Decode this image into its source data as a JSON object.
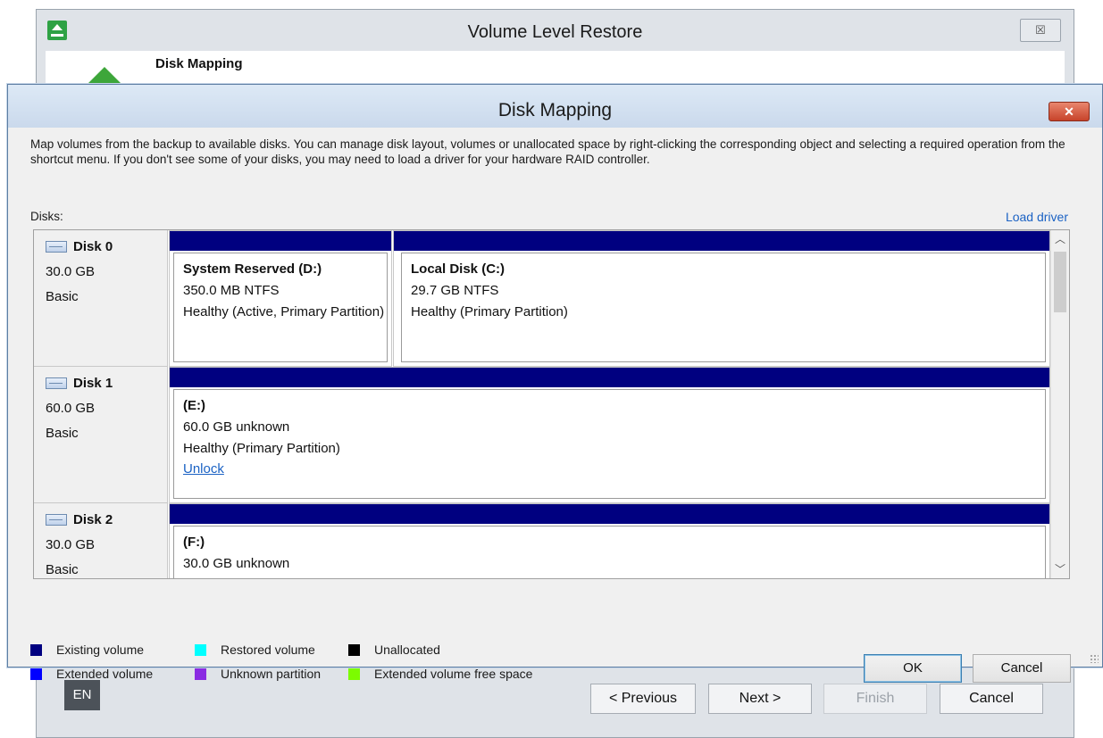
{
  "wizard": {
    "title": "Volume Level Restore",
    "close_glyph": "☒",
    "step_title": "Disk Mapping",
    "language": "EN",
    "buttons": {
      "previous": "< Previous",
      "next": "Next >",
      "finish": "Finish",
      "cancel": "Cancel"
    }
  },
  "dialog": {
    "title": "Disk Mapping",
    "close_glyph": "✕",
    "description": "Map volumes from the backup to available disks. You can manage disk layout, volumes or unallocated space by right-clicking the corresponding object and selecting a required operation from the shortcut menu. If you don't see some of your disks, you may need to load a driver for your hardware RAID controller.",
    "disks_label": "Disks:",
    "load_driver": "Load driver",
    "disks": [
      {
        "name": "Disk 0",
        "size": "30.0 GB",
        "type": "Basic",
        "volumes": [
          {
            "name": "System Reserved (D:)",
            "size": "350.0 MB NTFS",
            "status": "Healthy (Active, Primary Partition)"
          },
          {
            "name": "Local Disk (C:)",
            "size": "29.7 GB NTFS",
            "status": "Healthy (Primary Partition)"
          }
        ]
      },
      {
        "name": "Disk 1",
        "size": "60.0 GB",
        "type": "Basic",
        "volumes": [
          {
            "name": "(E:)",
            "size": "60.0 GB unknown",
            "status": "Healthy (Primary Partition)",
            "link": "Unlock"
          }
        ]
      },
      {
        "name": "Disk 2",
        "size": "30.0 GB",
        "type": "Basic",
        "volumes": [
          {
            "name": "(F:)",
            "size": "30.0 GB unknown"
          }
        ]
      }
    ],
    "legend": [
      {
        "label": "Existing volume",
        "color": "#000080"
      },
      {
        "label": "Restored volume",
        "color": "#00ffff"
      },
      {
        "label": "Unallocated",
        "color": "#000000"
      },
      {
        "label": "Extended volume",
        "color": "#0000ff"
      },
      {
        "label": "Unknown partition",
        "color": "#8a2be2"
      },
      {
        "label": "Extended volume free space",
        "color": "#7cfc00"
      }
    ],
    "buttons": {
      "ok": "OK",
      "cancel": "Cancel"
    }
  }
}
